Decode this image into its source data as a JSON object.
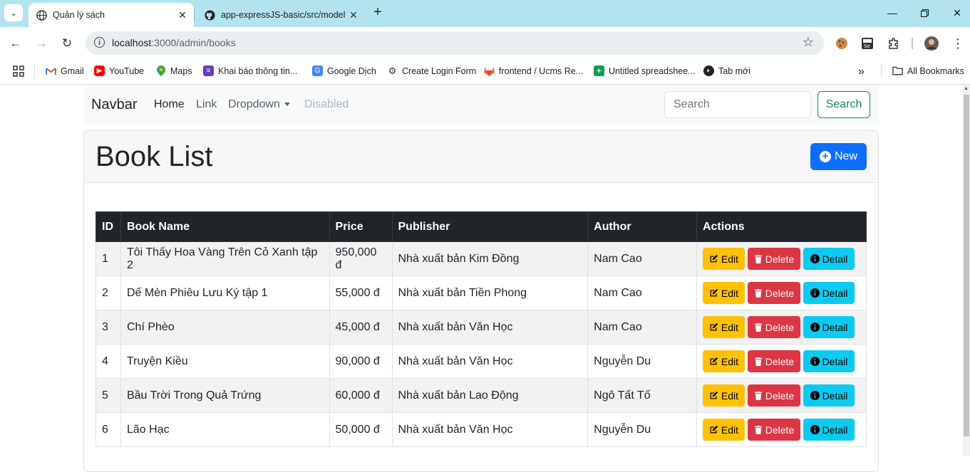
{
  "browser": {
    "tabs": [
      {
        "title": "Quản lý sách",
        "active": true
      },
      {
        "title": "app-expressJS-basic/src/model",
        "active": false
      }
    ],
    "url_host": "localhost",
    "url_path": ":3000/admin/books",
    "bookmarks": [
      {
        "label": "Gmail",
        "icon": "gmail-icon"
      },
      {
        "label": "YouTube",
        "icon": "youtube-icon"
      },
      {
        "label": "Maps",
        "icon": "maps-icon"
      },
      {
        "label": "Khai báo thông tin...",
        "icon": "form-icon"
      },
      {
        "label": "Google Dịch",
        "icon": "translate-icon"
      },
      {
        "label": "Create Login Form",
        "icon": "openai-icon"
      },
      {
        "label": "frontend / Ucms Re...",
        "icon": "gitlab-icon"
      },
      {
        "label": "Untitled spreadshee...",
        "icon": "sheets-icon"
      },
      {
        "label": "Tab mới",
        "icon": "globe-icon"
      }
    ],
    "all_bookmarks": "All Bookmarks"
  },
  "navbar": {
    "brand": "Navbar",
    "links": {
      "home": "Home",
      "link": "Link",
      "dropdown": "Dropdown",
      "disabled": "Disabled"
    },
    "search_placeholder": "Search",
    "search_button": "Search"
  },
  "page": {
    "title": "Book List",
    "new_button": "New"
  },
  "table": {
    "headers": [
      "ID",
      "Book Name",
      "Price",
      "Publisher",
      "Author",
      "Actions"
    ],
    "action_labels": {
      "edit": "Edit",
      "delete": "Delete",
      "detail": "Detail"
    },
    "rows": [
      {
        "id": "1",
        "name": "Tôi Thấy Hoa Vàng Trên Cỏ Xanh tập 2",
        "price": "950,000 đ",
        "publisher": "Nhà xuất bản Kim Đồng",
        "author": "Nam Cao"
      },
      {
        "id": "2",
        "name": "Dế Mèn Phiêu Lưu Ký tập 1",
        "price": "55,000 đ",
        "publisher": "Nhà xuất bản Tiền Phong",
        "author": "Nam Cao"
      },
      {
        "id": "3",
        "name": "Chí Phèo",
        "price": "45,000 đ",
        "publisher": "Nhà xuất bản Văn Học",
        "author": "Nam Cao"
      },
      {
        "id": "4",
        "name": "Truyện Kiều",
        "price": "90,000 đ",
        "publisher": "Nhà xuất bản Văn Học",
        "author": "Nguyễn Du"
      },
      {
        "id": "5",
        "name": "Bầu Trời Trong Quả Trứng",
        "price": "60,000 đ",
        "publisher": "Nhà xuất bản Lao Động",
        "author": "Ngô Tất Tố"
      },
      {
        "id": "6",
        "name": "Lão Hạc",
        "price": "50,000 đ",
        "publisher": "Nhà xuất bản Văn Học",
        "author": "Nguyễn Du"
      }
    ]
  },
  "colors": {
    "tabbar": "#b4e3f0",
    "primary": "#0d6efd",
    "success": "#198754",
    "warning": "#ffc107",
    "danger": "#dc3545",
    "info": "#0dcaf0",
    "table_head": "#212529"
  }
}
